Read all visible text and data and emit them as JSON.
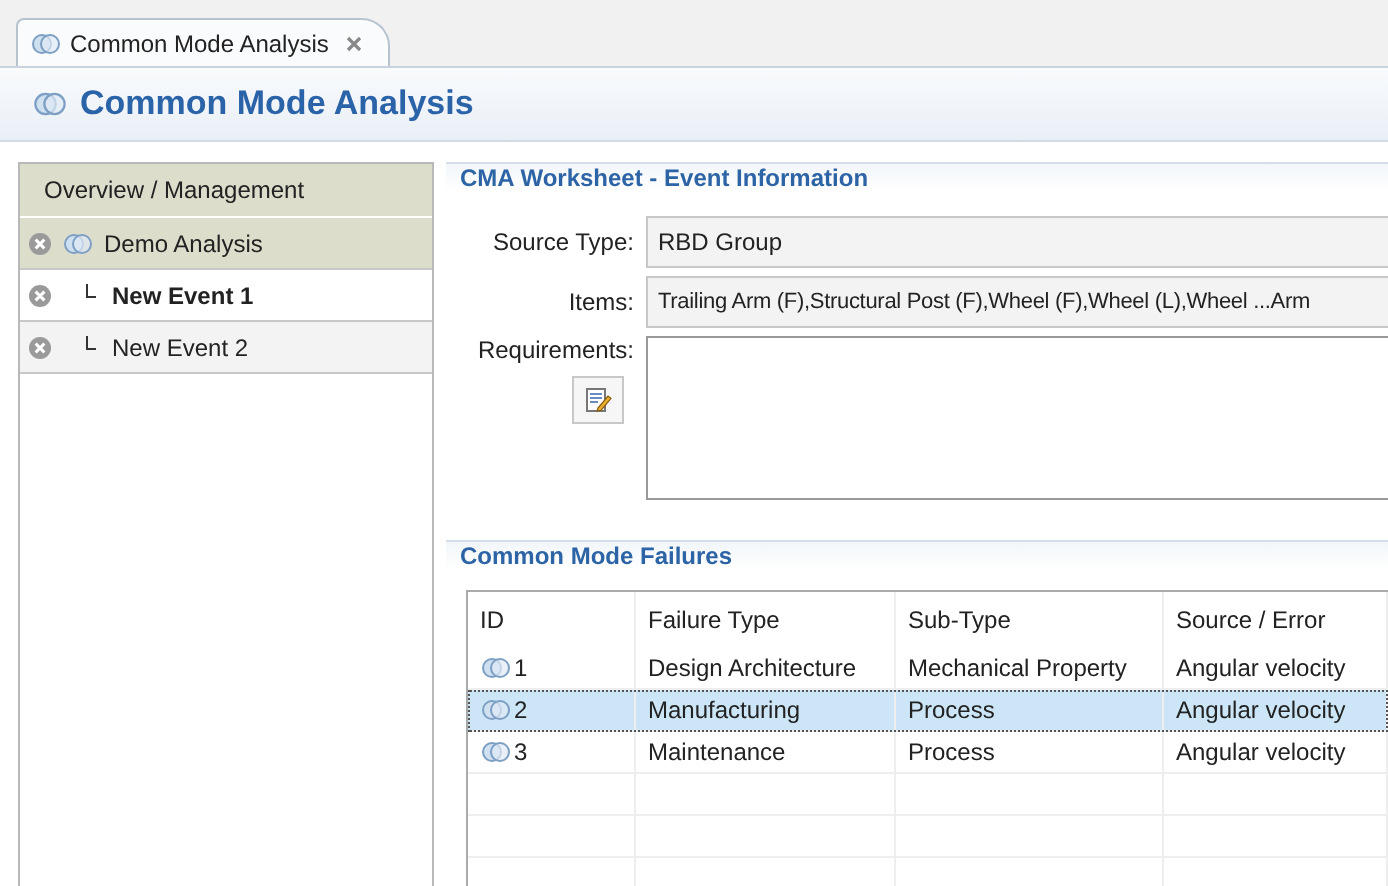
{
  "editor_tab": {
    "title": "Common Mode Analysis"
  },
  "header": {
    "title": "Common Mode Analysis"
  },
  "sidebar": {
    "heading": "Overview / Management",
    "items": [
      {
        "label": "Demo Analysis",
        "selected": false,
        "children": [
          {
            "label": "New Event 1",
            "selected": true
          },
          {
            "label": "New Event 2",
            "selected": false
          }
        ]
      }
    ]
  },
  "event_info": {
    "title": "CMA Worksheet - Event Information",
    "source_type": {
      "label": "Source Type:",
      "value": "RBD Group"
    },
    "items": {
      "label": "Items:",
      "value": "Trailing Arm (F),Structural Post (F),Wheel (F),Wheel (L),Wheel ...Arm"
    },
    "requirements": {
      "label": "Requirements:"
    }
  },
  "failures": {
    "title": "Common Mode Failures",
    "columns": [
      "ID",
      "Failure Type",
      "Sub-Type",
      "Source / Error"
    ],
    "rows": [
      {
        "cells": [
          "1",
          "Design Architecture",
          "Mechanical Property",
          "Angular velocity"
        ],
        "selected": false
      },
      {
        "cells": [
          "2",
          "Manufacturing",
          "Process",
          "Angular velocity"
        ],
        "selected": true
      },
      {
        "cells": [
          "3",
          "Maintenance",
          "Process",
          "Angular velocity"
        ],
        "selected": false
      }
    ]
  }
}
